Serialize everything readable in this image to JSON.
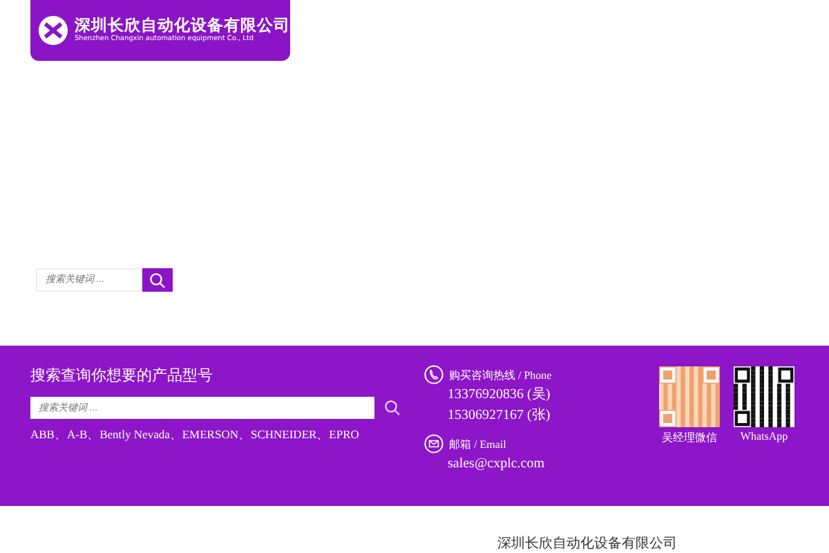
{
  "header": {
    "logo_title": "深圳长欣自动化设备有限公司",
    "logo_subtitle": "Shenzhen Changxin automation equipment Co., Ltd"
  },
  "search": {
    "placeholder": "搜索关键词 ..."
  },
  "footer": {
    "search_title": "搜索查询你想要的产品型号",
    "search_placeholder": "搜索关键词 ...",
    "brands": "ABB、A-B、Bently Nevada、EMERSON、SCHNEIDER、EPRO",
    "phone_label": "购买咨询热线 / Phone",
    "phones": [
      "13376920836 (吴)",
      "15306927167 (张)"
    ],
    "email_label": "邮箱 / Email",
    "email": "sales@cxplc.com",
    "qr_codes": [
      {
        "kind": "wechat",
        "caption": "吴经理微信"
      },
      {
        "kind": "whatsapp",
        "caption": "WhatsApp"
      }
    ]
  },
  "bottom": {
    "company": "深圳长欣自动化设备有限公司"
  }
}
